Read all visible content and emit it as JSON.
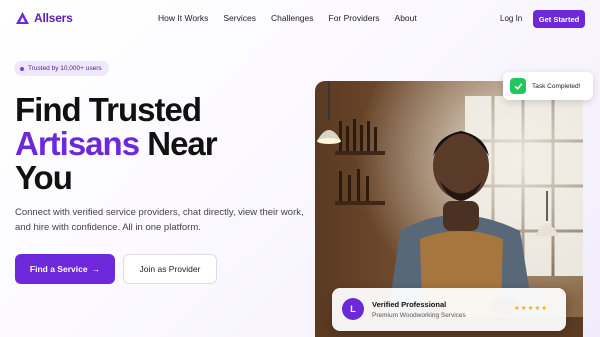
{
  "brand": {
    "name": "Allsers",
    "color": "#5b21b6"
  },
  "nav": {
    "links": [
      "How It Works",
      "Services",
      "Challenges",
      "For Providers",
      "About"
    ],
    "login": "Log In",
    "cta": "Get Started"
  },
  "hero": {
    "badge": "Trusted by 10,000+ users",
    "headline_line1": "Find Trusted",
    "headline_accent": "Artisans",
    "headline_line2": "Near",
    "headline_line3": "You",
    "subtext": "Connect with verified service providers, chat directly, view their work, and hire with confidence. All in one platform.",
    "primary_button": "Find a Service",
    "primary_arrow": "→",
    "secondary_button": "Join as Provider"
  },
  "toast": {
    "icon": "check-icon",
    "text": "Task Completed!"
  },
  "provider_card": {
    "avatar_letter": "L",
    "title": "Verified Professional",
    "subtitle": "Premium Woodworking Services",
    "stars": "★★★★★",
    "rating": 5
  },
  "colors": {
    "accent": "#6d28d9",
    "success": "#22c55e",
    "star": "#f5b301"
  }
}
